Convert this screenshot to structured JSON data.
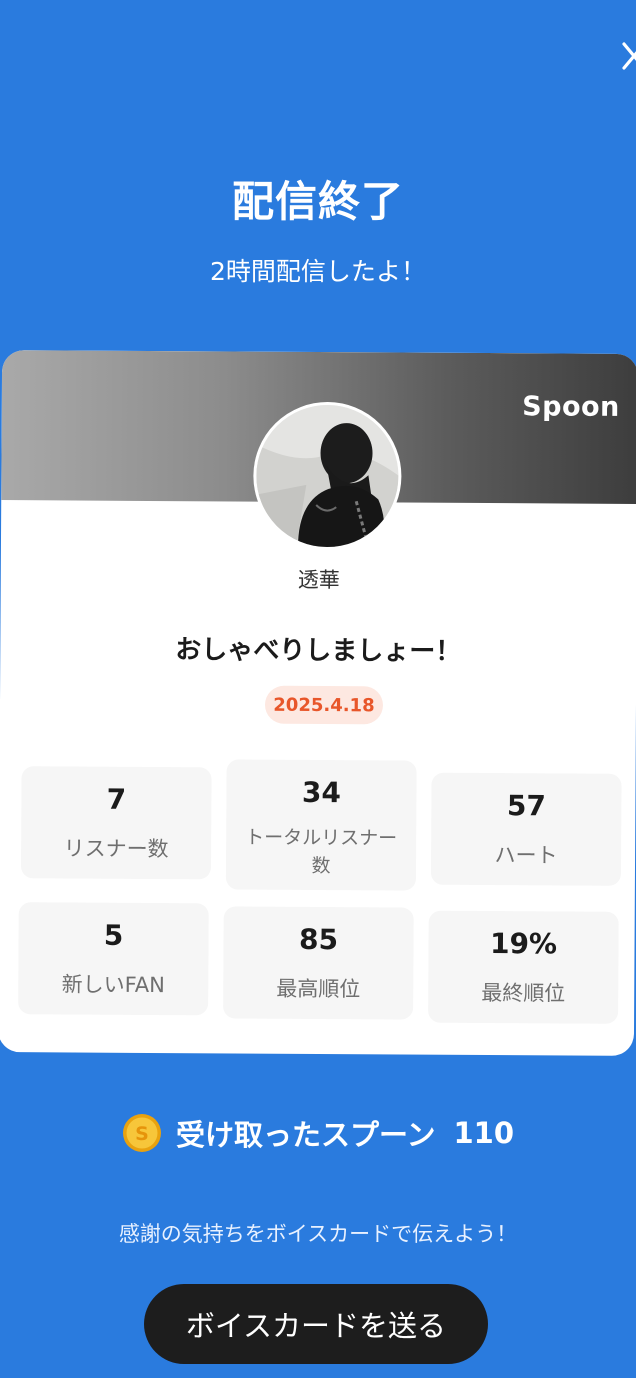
{
  "header": {
    "title": "配信終了",
    "subtitle": "2時間配信したよ！"
  },
  "card": {
    "brand": "Spoon",
    "username": "透華",
    "room_title": "おしゃべりしましょー！",
    "date": "2025.4.18",
    "stats": [
      {
        "value": "7",
        "label": "リスナー数"
      },
      {
        "value": "34",
        "label": "トータルリスナー数"
      },
      {
        "value": "57",
        "label": "ハート"
      },
      {
        "value": "5",
        "label": "新しいFAN"
      },
      {
        "value": "85",
        "label": "最高順位"
      },
      {
        "value": "19%",
        "label": "最終順位"
      }
    ]
  },
  "spoons": {
    "label": "受け取ったスプーン",
    "count": "110"
  },
  "footer": {
    "message": "感謝の気持ちをボイスカードで伝えよう！",
    "button_label": "ボイスカードを送る"
  },
  "colors": {
    "background": "#2a7bde",
    "date_text": "#e8562a",
    "date_bg": "#fde8e1",
    "button_bg": "#1d1d1d",
    "coin": "#f3b51f"
  },
  "icons": {
    "close": "close-icon",
    "coin": "spoon-coin-icon"
  }
}
